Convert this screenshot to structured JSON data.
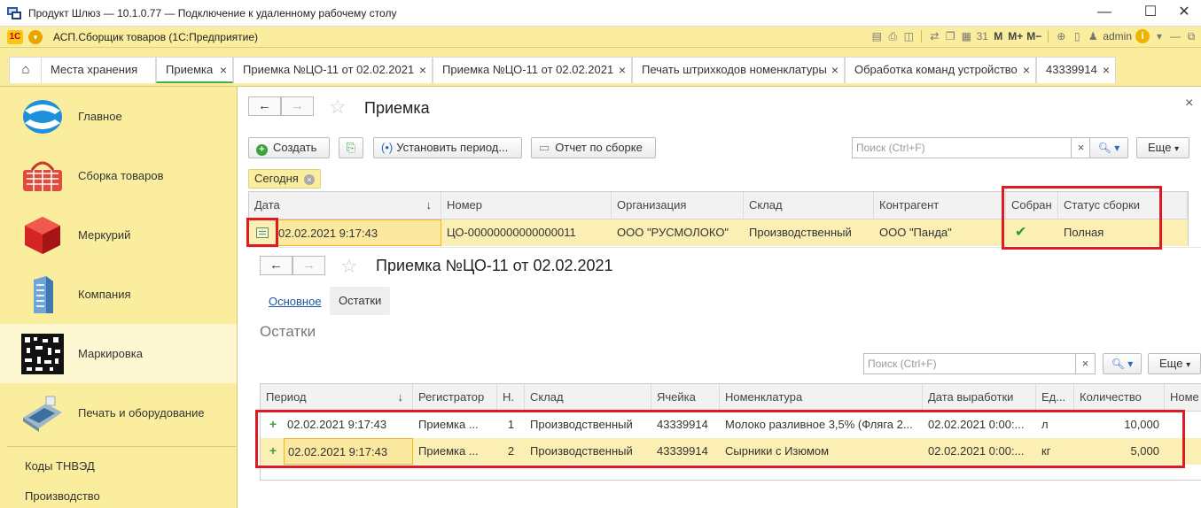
{
  "rdp": {
    "title": "Продукт Шлюз — 10.1.0.77 — Подключение к удаленному рабочему столу",
    "min": "—",
    "max": "☐",
    "close": "✕"
  },
  "app": {
    "logo": "1С",
    "title": "АСП.Сборщик товаров (1С:Предприятие)",
    "user": "admin",
    "toolbar": {
      "m": "M",
      "mplus": "M+",
      "mminus": "M−",
      "cal": "31",
      "info": "i"
    }
  },
  "tabs": [
    {
      "label": "Места хранения"
    },
    {
      "label": "Приемка"
    },
    {
      "label": "Приемка №ЦО-11 от 02.02.2021"
    },
    {
      "label": "Приемка №ЦО-11 от 02.02.2021"
    },
    {
      "label": "Печать штрихкодов номенклатуры"
    },
    {
      "label": "Обработка команд устройство"
    },
    {
      "label": "43339914"
    }
  ],
  "sidebar": {
    "items": [
      {
        "label": "Главное",
        "icon": "globe-icon"
      },
      {
        "label": "Сборка товаров",
        "icon": "basket-icon"
      },
      {
        "label": "Меркурий",
        "icon": "cube-icon"
      },
      {
        "label": "Компания",
        "icon": "building-icon"
      },
      {
        "label": "Маркировка",
        "icon": "datamatrix-icon"
      },
      {
        "label": "Печать и оборудование",
        "icon": "terminal-icon"
      }
    ],
    "links": [
      {
        "label": "Коды ТНВЭД"
      },
      {
        "label": "Производство"
      }
    ]
  },
  "list_form": {
    "title": "Приемка",
    "buttons": {
      "create": "Создать",
      "set_period": "Установить период...",
      "report": "Отчет по сборке",
      "more": "Еще"
    },
    "search_placeholder": "Поиск (Ctrl+F)",
    "filter_chip": "Сегодня",
    "columns": [
      "Дата",
      "Номер",
      "Организация",
      "Склад",
      "Контрагент",
      "Собран",
      "Статус сборки"
    ],
    "sort_arrow": "↓",
    "rows": [
      {
        "date": "02.02.2021 9:17:43",
        "number": "ЦО-00000000000000011",
        "org": "ООО \"РУСМОЛОКО\"",
        "warehouse": "Производственный",
        "contractor": "ООО \"Панда\"",
        "collected": "✔",
        "status": "Полная"
      }
    ]
  },
  "doc_form": {
    "title": "Приемка №ЦО-11 от 02.02.2021",
    "tabs": {
      "main": "Основное",
      "rest": "Остатки"
    },
    "section_title": "Остатки",
    "search_placeholder": "Поиск (Ctrl+F)",
    "more": "Еще",
    "columns": [
      "Период",
      "Регистратор",
      "Н.",
      "Склад",
      "Ячейка",
      "Номенклатура",
      "Дата выработки",
      "Ед...",
      "Количество",
      "Номе"
    ],
    "rows": [
      {
        "mark": "+",
        "period": "02.02.2021 9:17:43",
        "registrar": "Приемка ...",
        "n": "1",
        "warehouse": "Производственный",
        "cell": "43339914",
        "item": "Молоко разливное 3,5% (Фляга 2...",
        "prod_date": "02.02.2021 0:00:...",
        "unit": "л",
        "qty": "10,000"
      },
      {
        "mark": "+",
        "period": "02.02.2021 9:17:43",
        "registrar": "Приемка ...",
        "n": "2",
        "warehouse": "Производственный",
        "cell": "43339914",
        "item": "Сырники с Изюмом",
        "prod_date": "02.02.2021 0:00:...",
        "unit": "кг",
        "qty": "5,000"
      }
    ]
  }
}
